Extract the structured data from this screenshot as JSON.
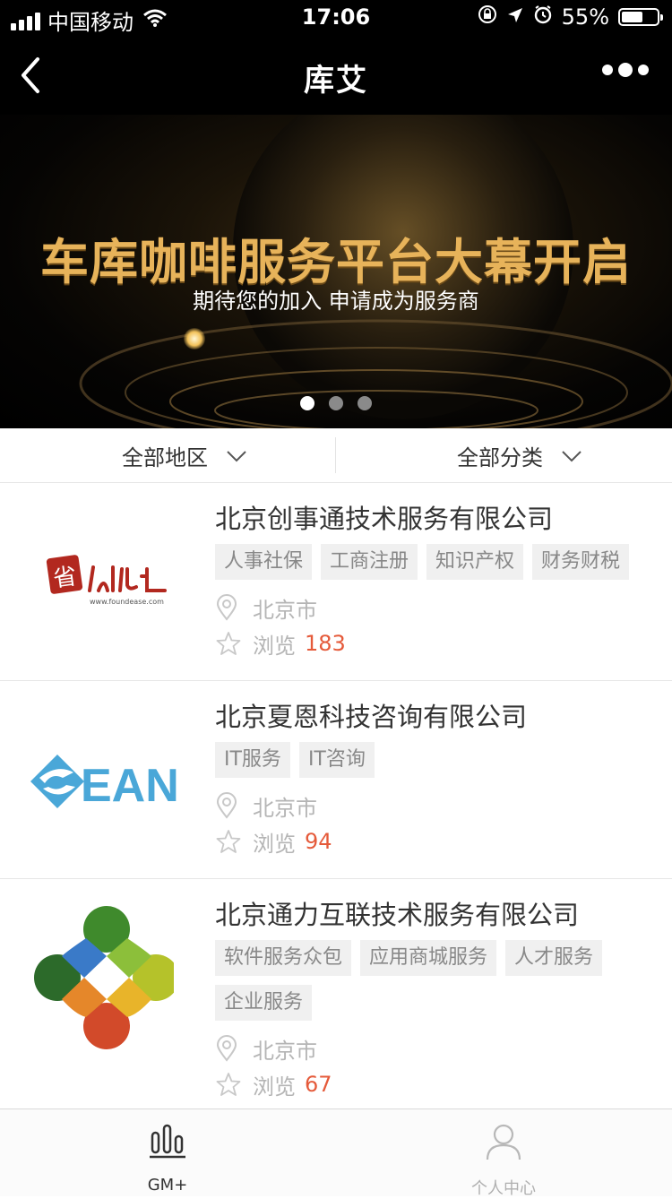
{
  "status_bar": {
    "carrier": "中国移动",
    "time": "17:06",
    "battery": "55%",
    "battery_level": 0.55,
    "icons": [
      "signal-icon",
      "wifi-icon",
      "rotation-lock-icon",
      "location-icon",
      "alarm-icon",
      "battery-icon"
    ]
  },
  "nav": {
    "title": "库艾",
    "back_icon": "chevron-left-icon",
    "more_icon": "more-dots-icon"
  },
  "banner": {
    "title": "车库咖啡服务平台大幕开启",
    "subtitle": "期待您的加入  申请成为服务商",
    "slide_count": 3,
    "active_slide": 1,
    "colors": {
      "title": "#e7b35a",
      "subtitle": "#ffffff"
    }
  },
  "filters": {
    "region_label": "全部地区",
    "category_label": "全部分类"
  },
  "companies": [
    {
      "name": "北京创事通技术服务有限公司",
      "tags": [
        "人事社保",
        "工商注册",
        "知识产权",
        "财务财税"
      ],
      "city": "北京市",
      "views_label": "浏览",
      "views": "183",
      "logo_text": "www.foundease.com",
      "logo_icon": "foundease-logo"
    },
    {
      "name": "北京夏恩科技咨询有限公司",
      "tags": [
        "IT服务",
        "IT咨询"
      ],
      "city": "北京市",
      "views_label": "浏览",
      "views": "94",
      "logo_text": "EAN",
      "logo_icon": "sean-logo"
    },
    {
      "name": "北京通力互联技术服务有限公司",
      "tags": [
        "软件服务众包",
        "应用商城服务",
        "人才服务",
        "企业服务"
      ],
      "city": "北京市",
      "views_label": "浏览",
      "views": "67",
      "logo_icon": "colorful-circles-logo"
    }
  ],
  "tabbar": {
    "tabs": [
      {
        "label": "GM+",
        "icon": "bars-icon",
        "active": true
      },
      {
        "label": "个人中心",
        "icon": "person-icon",
        "active": false
      }
    ]
  },
  "colors": {
    "accent": "#e55a3a",
    "tag_bg": "#f0f0f0",
    "muted": "#b5b5b5"
  }
}
